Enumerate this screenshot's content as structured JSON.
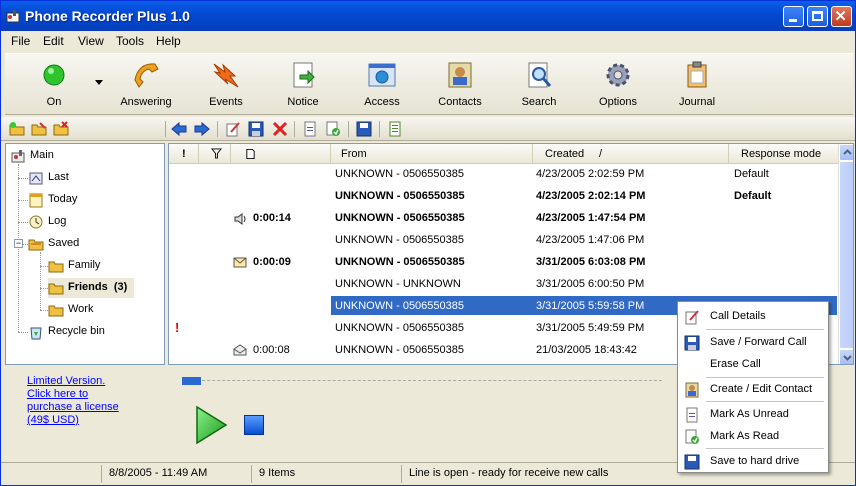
{
  "window": {
    "title": "Phone Recorder Plus 1.0"
  },
  "menu": [
    "File",
    "Edit",
    "View",
    "Tools",
    "Help"
  ],
  "toolbar": [
    {
      "label": "On",
      "icon": "power-on-icon"
    },
    {
      "label": "Answering",
      "icon": "phone-icon"
    },
    {
      "label": "Events",
      "icon": "events-icon"
    },
    {
      "label": "Notice",
      "icon": "notice-icon"
    },
    {
      "label": "Access",
      "icon": "access-icon"
    },
    {
      "label": "Contacts",
      "icon": "contacts-icon"
    },
    {
      "label": "Search",
      "icon": "search-icon"
    },
    {
      "label": "Options",
      "icon": "gear-icon"
    },
    {
      "label": "Journal",
      "icon": "journal-icon"
    }
  ],
  "tree": {
    "main": "Main",
    "items": [
      "Last",
      "Today",
      "Log"
    ],
    "saved": "Saved",
    "saved_children": [
      {
        "label": "Family"
      },
      {
        "label": "Friends  (3)"
      },
      {
        "label": "Work"
      }
    ],
    "recycle": "Recycle bin"
  },
  "promo": [
    "Limited Version.",
    "Click here to",
    "purchase a license",
    "(49$ USD)"
  ],
  "grid": {
    "columns": [
      "!",
      "From",
      "Created",
      "/",
      "Response mode"
    ],
    "rows": [
      {
        "flag": "",
        "icon": "",
        "duration": "",
        "from": "UNKNOWN - 0506550385",
        "created": "4/23/2005 2:02:59 PM",
        "mode": "Default",
        "bold": false
      },
      {
        "flag": "",
        "icon": "",
        "duration": "",
        "from": "UNKNOWN - 0506550385",
        "created": "4/23/2005 2:02:14 PM",
        "mode": "Default",
        "bold": true
      },
      {
        "flag": "",
        "icon": "speaker-icon",
        "duration": "0:00:14",
        "from": "UNKNOWN - 0506550385",
        "created": "4/23/2005 1:47:54 PM",
        "mode": "",
        "bold": true
      },
      {
        "flag": "",
        "icon": "",
        "duration": "",
        "from": "UNKNOWN - 0506550385",
        "created": "4/23/2005 1:47:06 PM",
        "mode": "",
        "bold": false
      },
      {
        "flag": "",
        "icon": "envelope-icon",
        "duration": "0:00:09",
        "from": "UNKNOWN - 0506550385",
        "created": "3/31/2005 6:03:08 PM",
        "mode": "",
        "bold": true
      },
      {
        "flag": "",
        "icon": "",
        "duration": "",
        "from": "UNKNOWN - UNKNOWN",
        "created": "3/31/2005 6:00:50 PM",
        "mode": "",
        "bold": false
      },
      {
        "flag": "",
        "icon": "",
        "duration": "",
        "from": "UNKNOWN - 0506550385",
        "created": "3/31/2005 5:59:58 PM",
        "mode": "",
        "bold": false,
        "selected": true
      },
      {
        "flag": "!",
        "icon": "",
        "duration": "",
        "from": "UNKNOWN - 0506550385",
        "created": "3/31/2005 5:49:59 PM",
        "mode": "",
        "bold": false
      },
      {
        "flag": "",
        "icon": "open-envelope-icon",
        "duration": "0:00:08",
        "from": "UNKNOWN - 0506550385",
        "created": "21/03/2005 18:43:42",
        "mode": "",
        "bold": false
      }
    ]
  },
  "player": {
    "progress": 0.04
  },
  "status": [
    "8/8/2005 - 11:49 AM",
    "9 Items",
    "Line is open - ready for receive new calls"
  ],
  "context_menu": [
    {
      "label": "Call Details",
      "icon": "edit-icon"
    },
    {
      "label": "Save / Forward Call",
      "icon": "floppy-icon"
    },
    {
      "label": "Erase Call",
      "icon": ""
    },
    {
      "label": "Create / Edit Contact",
      "icon": "contact-icon"
    },
    {
      "label": "Mark As Unread",
      "icon": "document-icon"
    },
    {
      "label": "Mark As Read",
      "icon": "document-check-icon"
    },
    {
      "label": "Save to hard drive",
      "icon": "floppy-icon"
    }
  ],
  "colors": {
    "titlebar": "#0449d4",
    "selection": "#316ac5",
    "link": "#0000ff"
  }
}
